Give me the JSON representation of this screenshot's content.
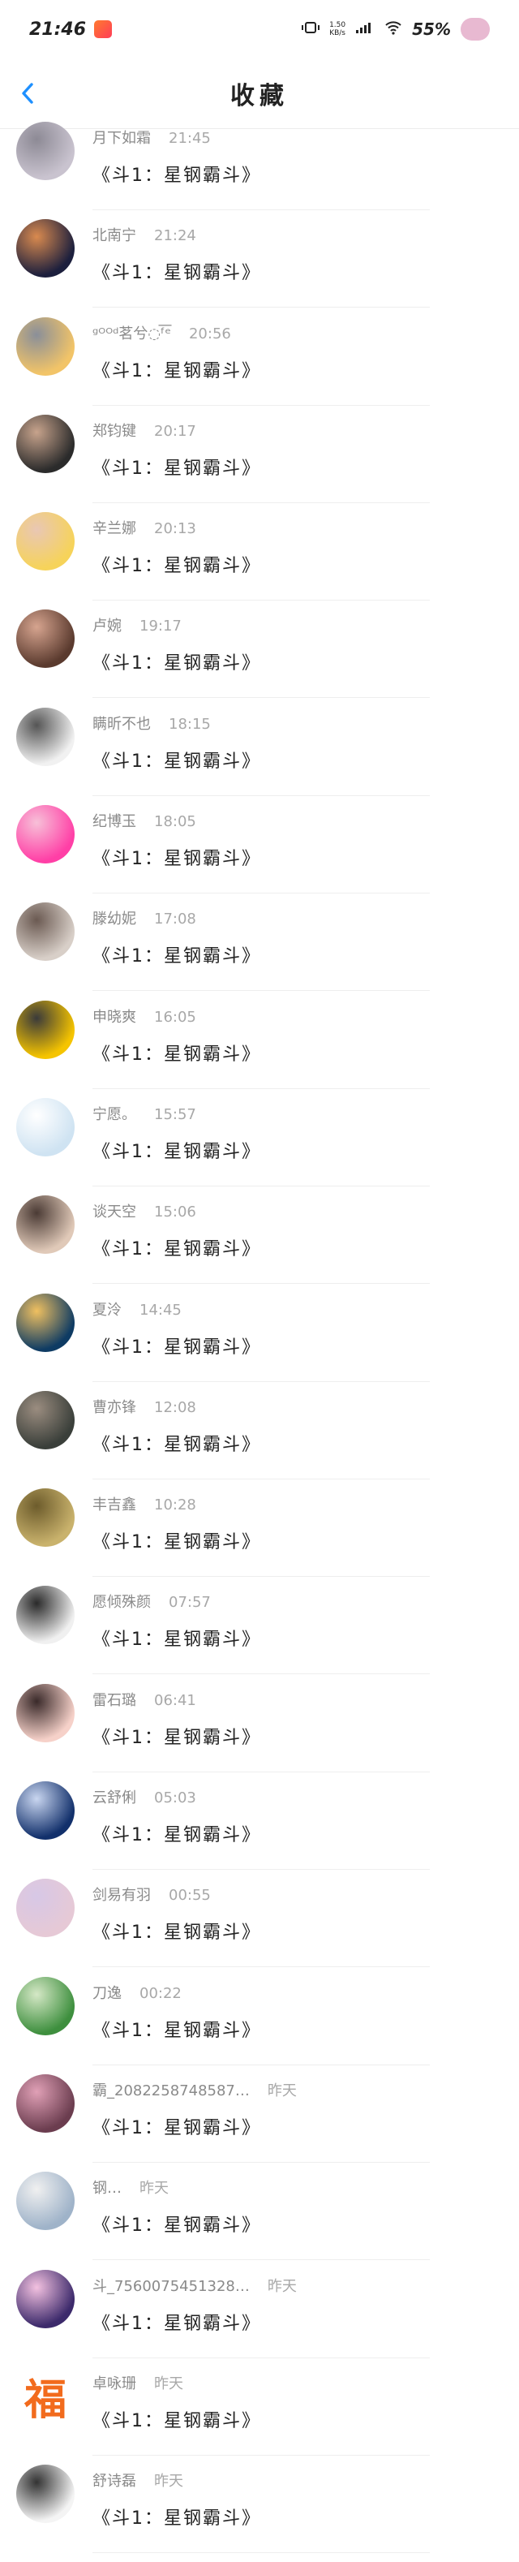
{
  "status": {
    "time": "21:46",
    "net_speed_value": "1.50",
    "net_speed_unit": "KB/s",
    "battery": "55%",
    "icons": [
      "app-notification-icon",
      "vibrate-icon",
      "signal-icon",
      "wifi-icon",
      "battery-icon"
    ]
  },
  "nav": {
    "title": "收藏",
    "back_icon": "chevron-left-icon",
    "accent": "#1e90ff"
  },
  "items": [
    {
      "name": "月下如霜",
      "time": "21:45",
      "title": "《斗1：星钢霸斗》",
      "avatar_colors": [
        "#c9c3cf",
        "#8d8a95"
      ]
    },
    {
      "name": "北南宁",
      "time": "21:24",
      "title": "《斗1：星钢霸斗》",
      "avatar_colors": [
        "#1c1f3d",
        "#d98a4f"
      ]
    },
    {
      "name": "ᵍᴼᴼᵈ茗兮◌ᶠ͞ᵉ",
      "time": "20:56",
      "title": "《斗1：星钢霸斗》",
      "avatar_colors": [
        "#f2c468",
        "#8a8f99"
      ]
    },
    {
      "name": "郑钧键",
      "time": "20:17",
      "title": "《斗1：星钢霸斗》",
      "avatar_colors": [
        "#2b2b2b",
        "#c7a38c"
      ]
    },
    {
      "name": "辛兰娜",
      "time": "20:13",
      "title": "《斗1：星钢霸斗》",
      "avatar_colors": [
        "#f6d35a",
        "#e9c7b4"
      ]
    },
    {
      "name": "卢婉",
      "time": "19:17",
      "title": "《斗1：星钢霸斗》",
      "avatar_colors": [
        "#5a3a2e",
        "#d6a48f"
      ]
    },
    {
      "name": "瞒昕不也",
      "time": "18:15",
      "title": "《斗1：星钢霸斗》",
      "avatar_colors": [
        "#f1f1f1",
        "#555555"
      ]
    },
    {
      "name": "纪博玉",
      "time": "18:05",
      "title": "《斗1：星钢霸斗》",
      "avatar_colors": [
        "#ff3fa6",
        "#f7c0d8"
      ]
    },
    {
      "name": "滕幼妮",
      "time": "17:08",
      "title": "《斗1：星钢霸斗》",
      "avatar_colors": [
        "#d8cfc8",
        "#6b5a52"
      ]
    },
    {
      "name": "申晓爽",
      "time": "16:05",
      "title": "《斗1：星钢霸斗》",
      "avatar_colors": [
        "#f5c400",
        "#3a3a3a"
      ]
    },
    {
      "name": "宁愿。",
      "time": "15:57",
      "title": "《斗1：星钢霸斗》",
      "avatar_colors": [
        "#cfe3f2",
        "#ffffff"
      ]
    },
    {
      "name": "谈天空",
      "time": "15:06",
      "title": "《斗1：星钢霸斗》",
      "avatar_colors": [
        "#e0c9b8",
        "#4b3b35"
      ]
    },
    {
      "name": "夏泠",
      "time": "14:45",
      "title": "《斗1：星钢霸斗》",
      "avatar_colors": [
        "#0e3b63",
        "#f0c060"
      ]
    },
    {
      "name": "曹亦锋",
      "time": "12:08",
      "title": "《斗1：星钢霸斗》",
      "avatar_colors": [
        "#3a3f3a",
        "#9b8d80"
      ]
    },
    {
      "name": "丰吉鑫",
      "time": "10:28",
      "title": "《斗1：星钢霸斗》",
      "avatar_colors": [
        "#c9b26c",
        "#6d5c2c"
      ]
    },
    {
      "name": "愿倾殊颜",
      "time": "07:57",
      "title": "《斗1：星钢霸斗》",
      "avatar_colors": [
        "#f0f0f0",
        "#2a2a2a"
      ]
    },
    {
      "name": "雷石璐",
      "time": "06:41",
      "title": "《斗1：星钢霸斗》",
      "avatar_colors": [
        "#f6d1c9",
        "#3a2a2a"
      ]
    },
    {
      "name": "云舒俐",
      "time": "05:03",
      "title": "《斗1：星钢霸斗》",
      "avatar_colors": [
        "#12306b",
        "#c9d6f0"
      ]
    },
    {
      "name": "剑易有羽",
      "time": "00:55",
      "title": "《斗1：星钢霸斗》",
      "avatar_colors": [
        "#e6c9d6",
        "#d7c8e6"
      ]
    },
    {
      "name": "刀逸",
      "time": "00:22",
      "title": "《斗1：星钢霸斗》",
      "avatar_colors": [
        "#3e8f3e",
        "#d5e8c6"
      ]
    },
    {
      "name": "霸_2082258748587…",
      "time": "昨天",
      "title": "《斗1：星钢霸斗》",
      "avatar_colors": [
        "#6b3d4f",
        "#e0a0b6"
      ]
    },
    {
      "name": "钢…",
      "time": "昨天",
      "title": "《斗1：星钢霸斗》",
      "avatar_colors": [
        "#9fb3c9",
        "#f0f0f0"
      ]
    },
    {
      "name": "斗_7560075451328…",
      "time": "昨天",
      "title": "《斗1：星钢霸斗》",
      "avatar_colors": [
        "#3c2a6b",
        "#f3c1e0"
      ]
    },
    {
      "name": "卓咏珊",
      "time": "昨天",
      "title": "《斗1：星钢霸斗》",
      "avatar_colors": [
        "#ffffff",
        "#f26b1d"
      ],
      "avatar_glyph": "福"
    },
    {
      "name": "舒诗磊",
      "time": "昨天",
      "title": "《斗1：星钢霸斗》",
      "avatar_colors": [
        "#f4f4f4",
        "#333333"
      ]
    }
  ]
}
